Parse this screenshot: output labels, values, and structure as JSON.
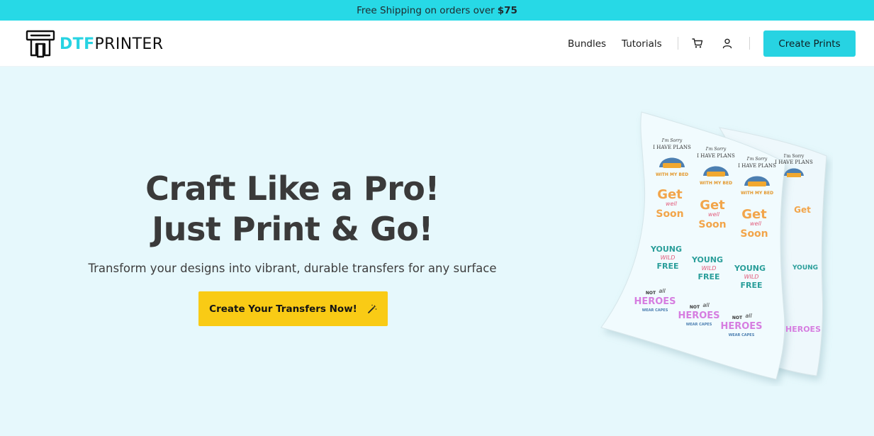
{
  "announcement": {
    "text": "Free Shipping on orders over",
    "amount": "$75"
  },
  "brand": {
    "name_accent": "DTF",
    "name_rest": "PRINTER",
    "accent_color": "#27d3e2"
  },
  "nav": {
    "bundles": "Bundles",
    "tutorials": "Tutorials",
    "cart_icon": "cart-icon",
    "account_icon": "user-icon",
    "cta": "Create Prints"
  },
  "hero": {
    "title_line1": "Craft Like a Pro!",
    "title_line2": "Just Print & Go!",
    "subtitle": "Transform your designs into vibrant, durable transfers for any surface",
    "cta": "Create Your Transfers Now!",
    "cta_icon": "magic-wand-icon",
    "cta_color": "#f9cb15"
  },
  "sheet_designs": {
    "plans_top": "I'm Sorry",
    "plans_main": "I HAVE PLANS",
    "plans_bottom": "WITH MY BED",
    "soon_main": "Get",
    "soon_script": "well",
    "soon_bottom": "Soon",
    "young_line1": "YOUNG",
    "young_line2": "WILD",
    "young_line3": "FREE",
    "heroes_top": "NOT",
    "heroes_script": "all",
    "heroes_main": "HEROES",
    "heroes_bottom": "WEAR CAPES"
  }
}
